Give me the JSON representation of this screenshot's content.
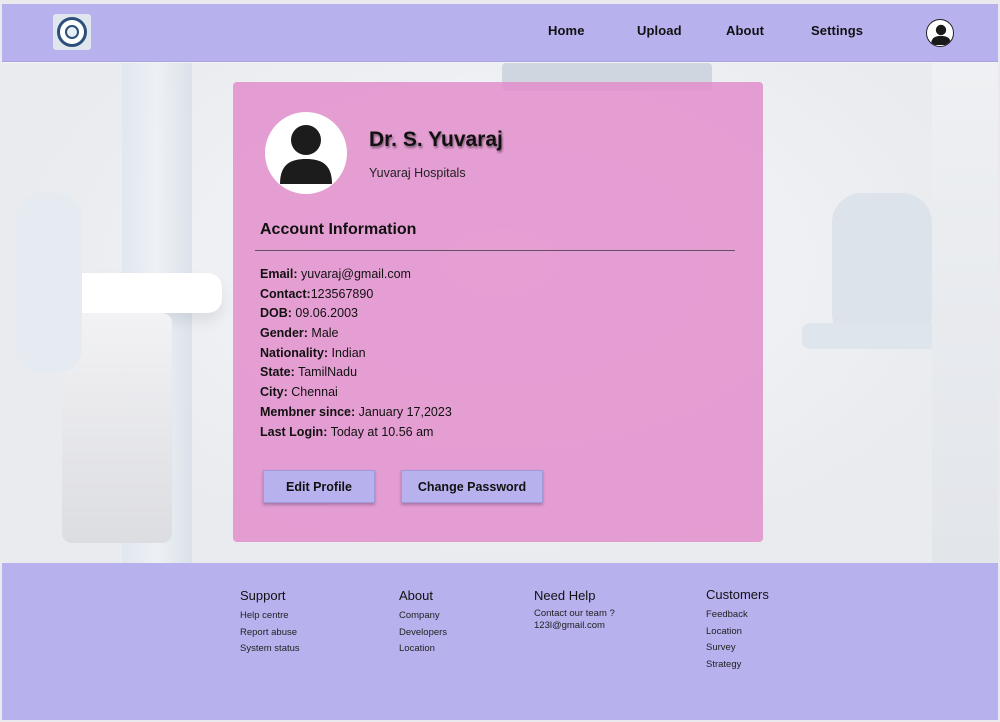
{
  "nav": {
    "links": [
      "Home",
      "Upload",
      "About",
      "Settings"
    ]
  },
  "profile": {
    "name": "Dr. S. Yuvaraj",
    "hospital": "Yuvaraj Hospitals",
    "section_title": "Account Information",
    "fields": [
      {
        "label": "Email:",
        "value": " yuvaraj@gmail.com"
      },
      {
        "label": "Contact:",
        "value": "123567890"
      },
      {
        "label": "DOB:",
        "value": " 09.06.2003"
      },
      {
        "label": "Gender:",
        "value": " Male"
      },
      {
        "label": "Nationality:",
        "value": " Indian"
      },
      {
        "label": "State:",
        "value": " TamilNadu"
      },
      {
        "label": "City:",
        "value": " Chennai"
      },
      {
        "label": "Membner since:",
        "value": " January 17,2023"
      },
      {
        "label": "Last Login:",
        "value": " Today at 10.56 am"
      }
    ],
    "edit_button": "Edit Profile",
    "password_button": "Change Password"
  },
  "footer": {
    "support": {
      "title": "Support",
      "links": [
        "Help centre",
        "Report abuse",
        "System status"
      ]
    },
    "about": {
      "title": "About",
      "links": [
        "Company",
        "Developers",
        "Location"
      ]
    },
    "help": {
      "title": "Need Help",
      "links": [
        "Contact our team ?",
        "123l@gmail.com"
      ]
    },
    "customers": {
      "title": "Customers",
      "links": [
        "Feedback",
        "Location",
        "Survey",
        "Strategy"
      ]
    }
  },
  "colors": {
    "accent": "#b7b1ee",
    "card": "#e28bcb"
  }
}
